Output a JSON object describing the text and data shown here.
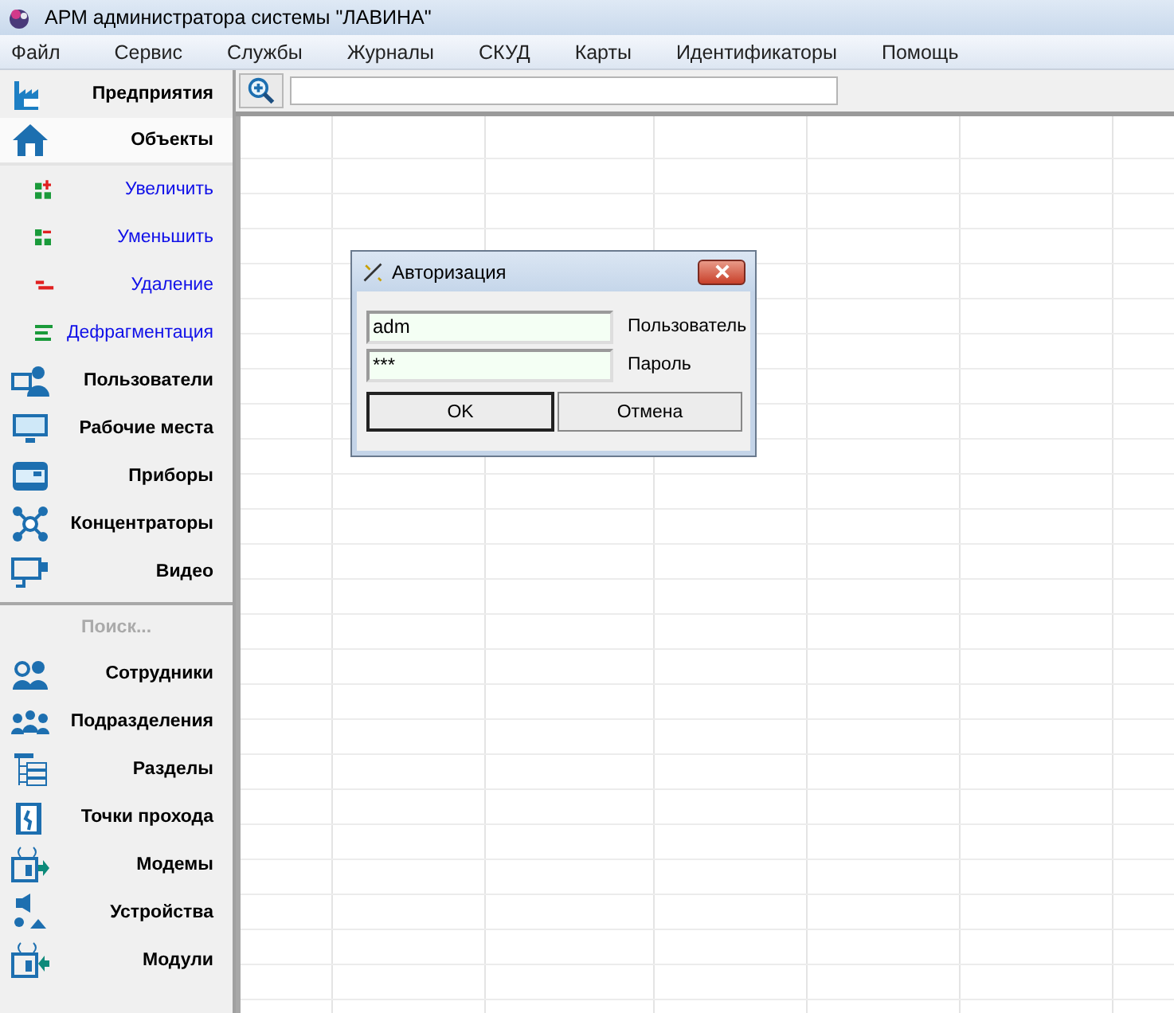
{
  "window": {
    "title": "АРМ администратора системы \"ЛАВИНА\""
  },
  "menu": [
    "Файл",
    "Сервис",
    "Службы",
    "Журналы",
    "СКУД",
    "Карты",
    "Идентификаторы",
    "Помощь"
  ],
  "sidebar": {
    "top_items": [
      {
        "label": "Предприятия",
        "kind": "header",
        "selected": false
      },
      {
        "label": "Объекты",
        "kind": "header",
        "selected": true
      },
      {
        "label": "Увеличить",
        "kind": "action",
        "selected": false
      },
      {
        "label": "Уменьшить",
        "kind": "action",
        "selected": false
      },
      {
        "label": "Удаление",
        "kind": "action",
        "selected": false
      },
      {
        "label": "Дефрагментация",
        "kind": "action",
        "selected": false
      },
      {
        "label": "Пользователи",
        "kind": "header",
        "selected": false
      },
      {
        "label": "Рабочие места",
        "kind": "header",
        "selected": false
      },
      {
        "label": "Приборы",
        "kind": "header",
        "selected": false
      },
      {
        "label": "Концентраторы",
        "kind": "header",
        "selected": false
      },
      {
        "label": "Видео",
        "kind": "header",
        "selected": false
      }
    ],
    "search": {
      "placeholder": "Поиск..."
    },
    "bottom_items": [
      {
        "label": "Сотрудники",
        "selected": false
      },
      {
        "label": "Подразделения",
        "selected": false
      },
      {
        "label": "Разделы",
        "selected": false
      },
      {
        "label": "Точки прохода",
        "selected": false
      },
      {
        "label": "Модемы",
        "selected": false
      },
      {
        "label": "Устройства",
        "selected": false
      },
      {
        "label": "Модули",
        "selected": false
      }
    ]
  },
  "dialog": {
    "title": "Авторизация",
    "fields": [
      {
        "label": "Пользователь",
        "value": "adm"
      },
      {
        "label": "Пароль",
        "value": "***"
      }
    ],
    "buttons": [
      {
        "label": "OK",
        "default": true
      },
      {
        "label": "Отмена",
        "default": false
      }
    ]
  }
}
